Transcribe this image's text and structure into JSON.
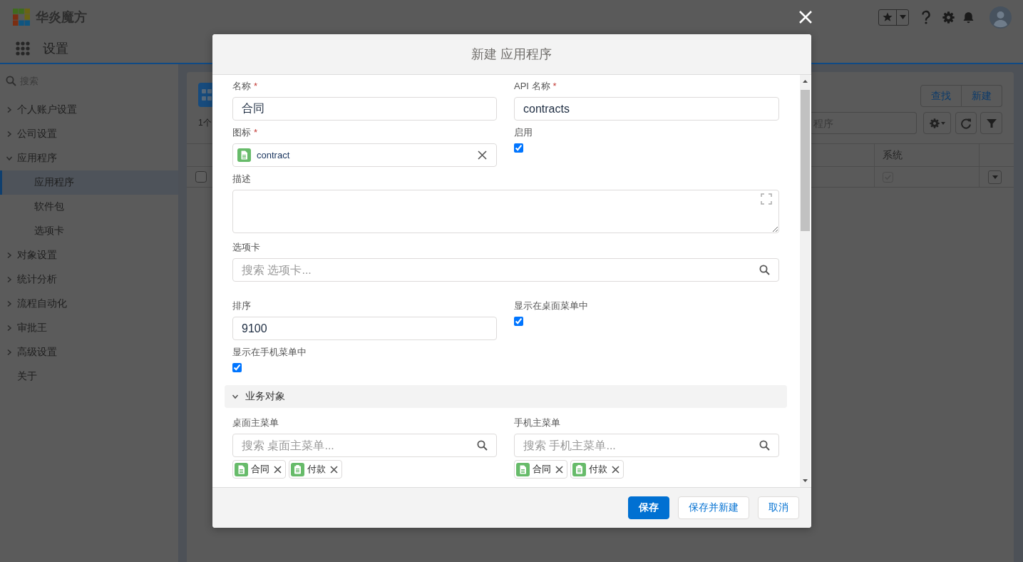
{
  "header": {
    "logo_text": "华炎魔方",
    "app_title": "设置"
  },
  "sidebar": {
    "search_placeholder": "搜索",
    "items": [
      {
        "label": "个人账户设置",
        "kind": "group",
        "expanded": false,
        "selected": false
      },
      {
        "label": "公司设置",
        "kind": "group",
        "expanded": false,
        "selected": false
      },
      {
        "label": "应用程序",
        "kind": "group",
        "expanded": true,
        "selected": false,
        "children": [
          {
            "label": "应用程序",
            "selected": true
          },
          {
            "label": "软件包",
            "selected": false
          },
          {
            "label": "选项卡",
            "selected": false
          }
        ]
      },
      {
        "label": "对象设置",
        "kind": "group",
        "expanded": false,
        "selected": false
      },
      {
        "label": "统计分析",
        "kind": "group",
        "expanded": false,
        "selected": false
      },
      {
        "label": "流程自动化",
        "kind": "group",
        "expanded": false,
        "selected": false
      },
      {
        "label": "审批王",
        "kind": "group",
        "expanded": false,
        "selected": false
      },
      {
        "label": "高级设置",
        "kind": "group",
        "expanded": false,
        "selected": false
      },
      {
        "label": "关于",
        "kind": "link",
        "selected": false
      }
    ]
  },
  "content": {
    "count_text": "1个",
    "buttons": [
      "查找",
      "新建"
    ],
    "search_placeholder": "程序",
    "table": {
      "columns": [
        {
          "label": "系统"
        }
      ],
      "rows": [
        {
          "selected": false,
          "system": true
        }
      ]
    }
  },
  "dialog": {
    "title": "新建 应用程序",
    "fields": [
      {
        "kind": "text",
        "label": "名称",
        "required_mark": "*",
        "value": "合同"
      },
      {
        "kind": "text",
        "label": "API 名称",
        "required_mark": "*",
        "value": "contracts"
      },
      {
        "kind": "lookup",
        "label": "图标",
        "required_mark": "*",
        "value": "contract"
      },
      {
        "kind": "checkbox",
        "label": "启用",
        "checked": true
      },
      {
        "kind": "textarea",
        "label": "描述"
      },
      {
        "kind": "multi_lookup",
        "label": "选项卡",
        "placeholder": "搜索 选项卡...",
        "wide": true
      },
      {
        "kind": "text",
        "label": "排序",
        "value": "9100"
      },
      {
        "kind": "checkbox",
        "label": "显示在桌面菜单中",
        "checked": true
      },
      {
        "kind": "checkbox",
        "label": "显示在手机菜单中",
        "checked": true
      }
    ],
    "sections": [
      {
        "title": "业务对象",
        "expanded": true,
        "fields": [
          {
            "kind": "multi_lookup",
            "label": "桌面主菜单",
            "placeholder": "搜索 桌面主菜单...",
            "wide": false,
            "items": [
              {
                "label": "合同",
                "kind": "document"
              },
              {
                "label": "付款",
                "kind": "clipboard"
              }
            ]
          },
          {
            "kind": "multi_lookup",
            "label": "手机主菜单",
            "placeholder": "搜索 手机主菜单...",
            "wide": false,
            "items": [
              {
                "label": "合同",
                "kind": "document"
              },
              {
                "label": "付款",
                "kind": "clipboard"
              }
            ]
          }
        ]
      }
    ],
    "buttons": [
      {
        "label": "保存",
        "kind": "primary"
      },
      {
        "label": "保存并新建",
        "kind": "secondary"
      },
      {
        "label": "取消",
        "kind": "secondary"
      }
    ]
  }
}
